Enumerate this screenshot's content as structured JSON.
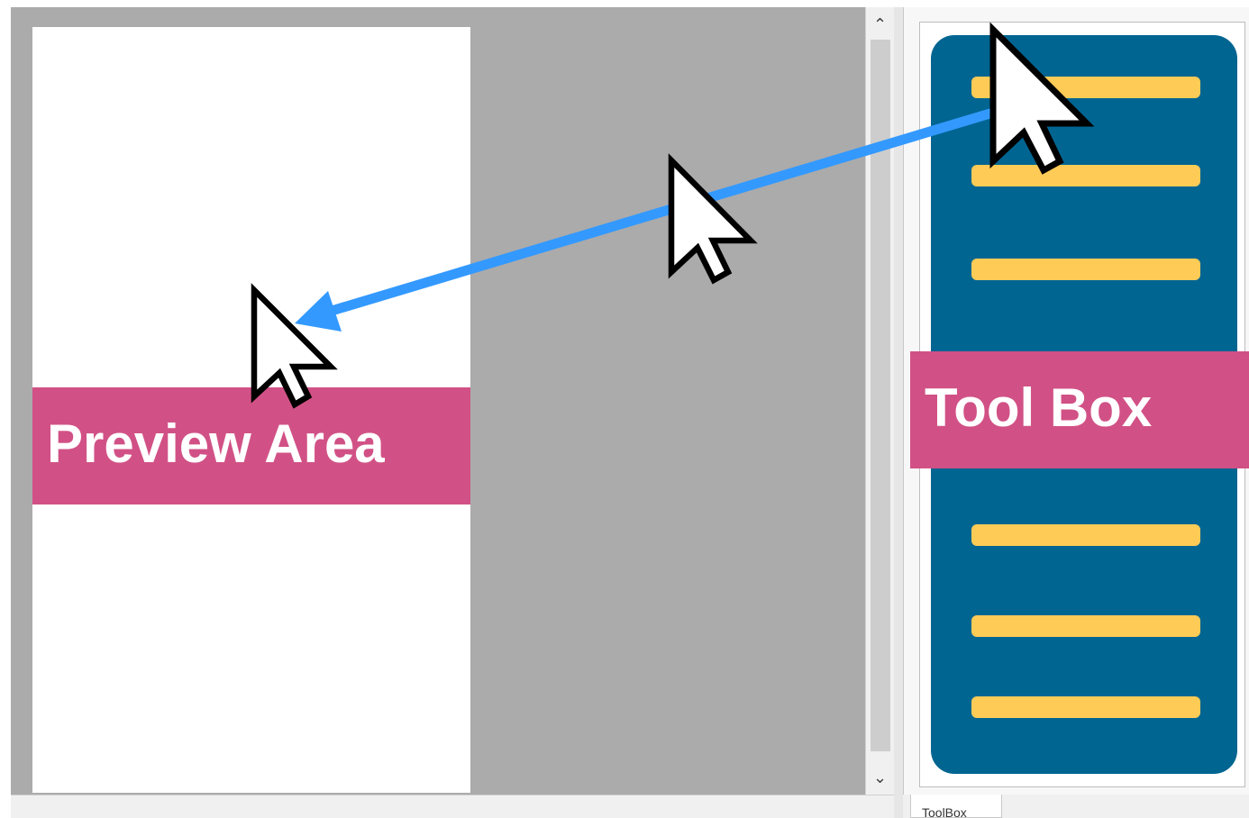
{
  "preview": {
    "label": "Preview  Area"
  },
  "toolbox": {
    "label": "Tool Box",
    "tab_label": "ToolBox",
    "line_count_top": 3,
    "line_count_bottom": 3
  },
  "scrollbar": {
    "up_icon": "chevron-up-icon",
    "down_icon": "chevron-down-icon"
  },
  "annotation": {
    "arrow_meaning": "drag from toolbox to preview area",
    "cursor_icon": "mouse-pointer-icon"
  },
  "colors": {
    "banner": "#d15186",
    "toolbox_bg": "#016591",
    "tool_line": "#fecb57",
    "arrow": "#3399ff",
    "editor_bg": "#ababab"
  }
}
